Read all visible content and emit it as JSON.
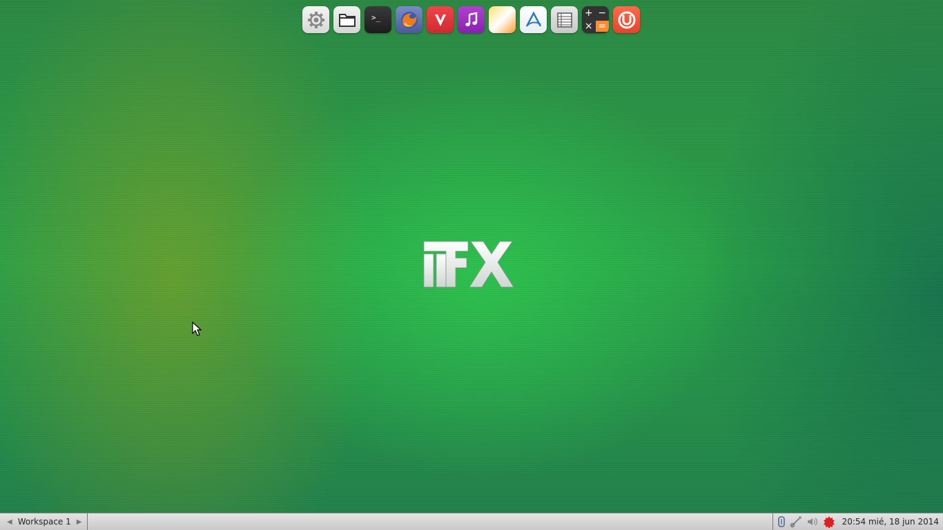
{
  "dock": {
    "items": [
      {
        "name": "system-settings",
        "icon": "gear-icon"
      },
      {
        "name": "files",
        "icon": "folder-icon"
      },
      {
        "name": "terminal",
        "icon": "terminal-icon"
      },
      {
        "name": "firefox",
        "icon": "firefox-icon"
      },
      {
        "name": "vivaldi",
        "icon": "vivaldi-icon"
      },
      {
        "name": "music-player",
        "icon": "music-note-icon"
      },
      {
        "name": "slices-app",
        "icon": "slices-icon"
      },
      {
        "name": "arc-app",
        "icon": "arc-icon"
      },
      {
        "name": "spreadsheet",
        "icon": "spreadsheet-icon"
      },
      {
        "name": "calculator",
        "icon": "calculator-icon"
      },
      {
        "name": "ubuntu-one",
        "icon": "ubuntu-one-icon"
      }
    ]
  },
  "desktop": {
    "logo_text": "FX",
    "logo_icon": "distro-logo-icon"
  },
  "panel": {
    "workspace": {
      "label": "Workspace 1",
      "prev_glyph": "◀",
      "next_glyph": "▶"
    },
    "tray": {
      "icons": [
        "clipboard-icon",
        "network-icon",
        "volume-icon",
        "update-notifier-icon"
      ],
      "clock": "20:54 mié, 18 jun 2014"
    }
  },
  "colors": {
    "panel_bg": "#d6d6d6",
    "desktop_green": "#2aa24a"
  }
}
